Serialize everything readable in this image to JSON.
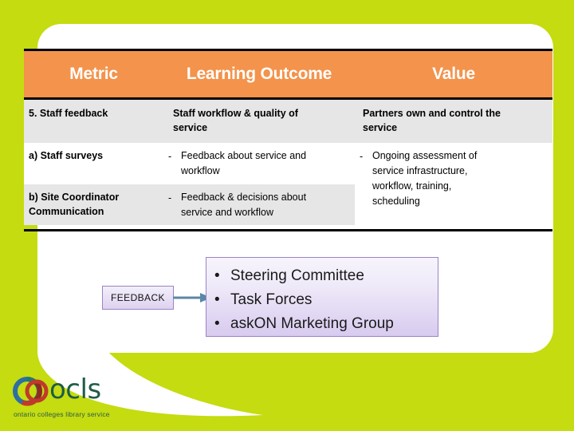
{
  "colors": {
    "background_green": "#c4dc10",
    "header_orange": "#f3934c",
    "row_gray": "#e6e6e6",
    "card_white": "#ffffff",
    "box_purple_border": "#9b84c4",
    "arrow_blue": "#5b87a8",
    "logo_green": "#1f5c46"
  },
  "table": {
    "headers": [
      "Metric",
      "Learning Outcome",
      "Value"
    ],
    "rows": [
      {
        "metric": "5.  Staff feedback",
        "outcome_lines": [
          "Staff workflow & quality of",
          "service"
        ],
        "value_lines": [
          "Partners own and control the",
          "service"
        ],
        "shaded": true
      },
      {
        "metric": "a)  Staff surveys",
        "outcome_dash": "-",
        "outcome_lines": [
          "Feedback about service and",
          "workflow"
        ],
        "value_dash": "-",
        "value_lines": [
          "Ongoing assessment of",
          "service infrastructure,",
          "workflow, training,",
          "scheduling"
        ],
        "shaded": false
      },
      {
        "metric": "b)  Site Coordinator Communication",
        "outcome_dash": "-",
        "outcome_lines": [
          "Feedback & decisions about",
          "service and workflow"
        ],
        "shaded": true
      }
    ]
  },
  "diagram": {
    "feedback_label": "FEEDBACK",
    "arrow_name": "arrow-right",
    "bullets": [
      "Steering Committee",
      "Task Forces",
      "askON Marketing Group"
    ],
    "bullet_glyph": "•"
  },
  "logo": {
    "wordmark": "ocls",
    "tagline": "ontario colleges library service"
  }
}
